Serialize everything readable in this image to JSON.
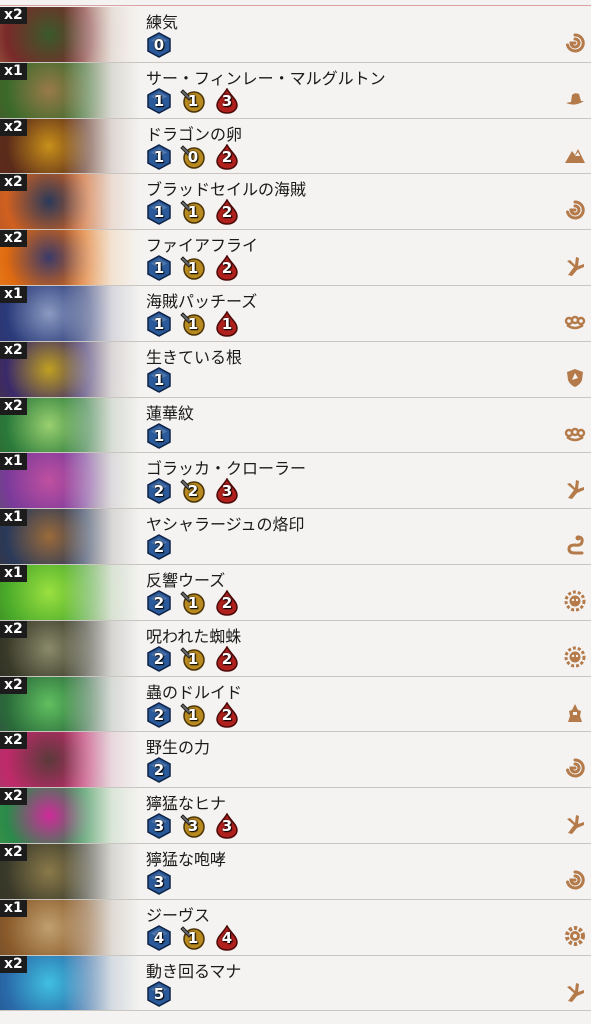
{
  "colors": {
    "mana": "#2b5a9a",
    "attack": "#b98a1f",
    "health": "#b0201d",
    "tribe_icon": "#b47a4a"
  },
  "cards": [
    {
      "count": "x2",
      "name": "練気",
      "cost": "0",
      "attack": null,
      "health": null,
      "tribe_icon": "swirl-icon",
      "art": [
        "#7a2a2a",
        "#3a5a2a",
        "#c9a060"
      ]
    },
    {
      "count": "x1",
      "name": "サー・フィンレー・マルグルトン",
      "cost": "1",
      "attack": "1",
      "health": "3",
      "tribe_icon": "hat-icon",
      "art": [
        "#3a6a2a",
        "#9a7a4a",
        "#5a3a2a"
      ]
    },
    {
      "count": "x2",
      "name": "ドラゴンの卵",
      "cost": "1",
      "attack": "0",
      "health": "2",
      "tribe_icon": "mountain-icon",
      "art": [
        "#5a2a1a",
        "#c8901a",
        "#6a3020"
      ]
    },
    {
      "count": "x2",
      "name": "ブラッドセイルの海賊",
      "cost": "1",
      "attack": "1",
      "health": "2",
      "tribe_icon": "swirl-icon",
      "art": [
        "#d06020",
        "#2a3a5a",
        "#9a4a2a"
      ]
    },
    {
      "count": "x2",
      "name": "ファイアフライ",
      "cost": "1",
      "attack": "1",
      "health": "2",
      "tribe_icon": "claw-icon",
      "art": [
        "#e06a10",
        "#3a3a6a",
        "#f0a030"
      ]
    },
    {
      "count": "x1",
      "name": "海賊パッチーズ",
      "cost": "1",
      "attack": "1",
      "health": "1",
      "tribe_icon": "knuckles-icon",
      "art": [
        "#2a3a7a",
        "#8a9ac0",
        "#3a2a5a"
      ]
    },
    {
      "count": "x2",
      "name": "生きている根",
      "cost": "1",
      "attack": null,
      "health": null,
      "tribe_icon": "shield-icon",
      "art": [
        "#3a2a6a",
        "#c0a020",
        "#5a3a1a"
      ]
    },
    {
      "count": "x2",
      "name": "蓮華紋",
      "cost": "1",
      "attack": null,
      "health": null,
      "tribe_icon": "knuckles-icon",
      "art": [
        "#2a7a3a",
        "#9ad070",
        "#3a4a2a"
      ]
    },
    {
      "count": "x1",
      "name": "ゴラッカ・クローラー",
      "cost": "2",
      "attack": "2",
      "health": "3",
      "tribe_icon": "claw-icon",
      "art": [
        "#7a3a9a",
        "#c050a0",
        "#3a6a3a"
      ]
    },
    {
      "count": "x1",
      "name": "ヤシャラージュの烙印",
      "cost": "2",
      "attack": null,
      "health": null,
      "tribe_icon": "snake-icon",
      "art": [
        "#2a3a5a",
        "#9a6a3a",
        "#4a2a1a"
      ]
    },
    {
      "count": "x1",
      "name": "反響ウーズ",
      "cost": "2",
      "attack": "1",
      "health": "2",
      "tribe_icon": "skull-gear-icon",
      "art": [
        "#4aaa2a",
        "#9ae040",
        "#2a5a1a"
      ]
    },
    {
      "count": "x2",
      "name": "呪われた蜘蛛",
      "cost": "2",
      "attack": "1",
      "health": "2",
      "tribe_icon": "skull-gear-icon",
      "art": [
        "#3a3a2a",
        "#8a8a6a",
        "#1a1a1a"
      ]
    },
    {
      "count": "x2",
      "name": "蟲のドルイド",
      "cost": "2",
      "attack": "1",
      "health": "2",
      "tribe_icon": "druid-icon",
      "art": [
        "#2a6a3a",
        "#60c060",
        "#3a2a4a"
      ]
    },
    {
      "count": "x2",
      "name": "野生の力",
      "cost": "2",
      "attack": null,
      "health": null,
      "tribe_icon": "swirl-icon",
      "art": [
        "#c02a6a",
        "#5a3a3a",
        "#8a4a6a"
      ]
    },
    {
      "count": "x2",
      "name": "獰猛なヒナ",
      "cost": "3",
      "attack": "3",
      "health": "3",
      "tribe_icon": "claw-icon",
      "art": [
        "#2a8a4a",
        "#d02a9a",
        "#5aa040"
      ]
    },
    {
      "count": "x2",
      "name": "獰猛な咆哮",
      "cost": "3",
      "attack": null,
      "health": null,
      "tribe_icon": "swirl-icon",
      "art": [
        "#3a3a2a",
        "#8a7a4a",
        "#2a2a1a"
      ]
    },
    {
      "count": "x1",
      "name": "ジーヴス",
      "cost": "4",
      "attack": "1",
      "health": "4",
      "tribe_icon": "gear-icon",
      "art": [
        "#8a5a2a",
        "#c0a070",
        "#4a3a2a"
      ]
    },
    {
      "count": "x2",
      "name": "動き回るマナ",
      "cost": "5",
      "attack": null,
      "health": null,
      "tribe_icon": "claw-icon",
      "art": [
        "#2a6aaa",
        "#40c0e0",
        "#1a3a6a"
      ]
    }
  ]
}
